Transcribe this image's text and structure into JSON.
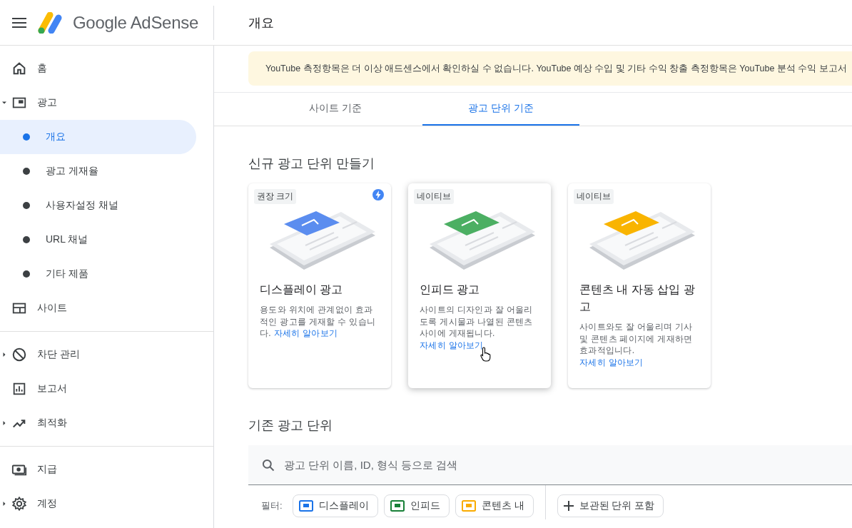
{
  "header": {
    "brand": "Google AdSense",
    "page_title": "개요"
  },
  "sidebar": {
    "groups": [
      {
        "items": [
          {
            "label": "홈"
          },
          {
            "label": "광고",
            "expanded": true,
            "children": [
              {
                "label": "개요",
                "selected": true
              },
              {
                "label": "광고 게재율",
                "selected": false
              },
              {
                "label": "사용자설정 채널",
                "selected": false
              },
              {
                "label": "URL 채널",
                "selected": false
              },
              {
                "label": "기타 제품",
                "selected": false
              }
            ]
          },
          {
            "label": "사이트"
          }
        ]
      },
      {
        "items": [
          {
            "label": "차단 관리",
            "expanded": false
          },
          {
            "label": "보고서"
          },
          {
            "label": "최적화",
            "expanded": false
          }
        ]
      },
      {
        "items": [
          {
            "label": "지급"
          },
          {
            "label": "계정",
            "expanded": false
          }
        ]
      }
    ]
  },
  "notice": "YouTube 측정항목은 더 이상 애드센스에서 확인하실 수 없습니다. YouTube 예상 수입 및 기타 수익 창출 측정항목은 YouTube 분석 수익 보고서",
  "tabs": [
    {
      "label": "사이트 기준",
      "selected": false
    },
    {
      "label": "광고 단위 기준",
      "selected": true
    }
  ],
  "new_section": {
    "title": "신규 광고 단위 만들기",
    "cards": [
      {
        "tag": "권장 크기",
        "recommended": true,
        "hovered": false,
        "color": "#5b8def",
        "title": "디스플레이 광고",
        "description": "용도와 위치에 관계없이 효과적인 광고를 게재할 수 있습니다.",
        "link": "자세히 알아보기"
      },
      {
        "tag": "네이티브",
        "recommended": false,
        "hovered": true,
        "color": "#4caf63",
        "title": "인피드 광고",
        "description": "사이트의 디자인과 잘 어울리도록 게시물과 나열된 콘텐츠 사이에 게재됩니다.",
        "link": "자세히 알아보기"
      },
      {
        "tag": "네이티브",
        "recommended": false,
        "hovered": false,
        "color": "#f9b400",
        "title": "콘텐츠 내 자동 삽입 광고",
        "description": "사이트와도 잘 어울리며 기사 및 콘텐츠 페이지에 게재하면 효과적입니다.",
        "link": "자세히 알아보기"
      }
    ]
  },
  "existing_section": {
    "title": "기존 광고 단위",
    "search": {
      "placeholder": "광고 단위 이름, ID, 형식 등으로 검색"
    },
    "filter_label": "필터:",
    "filters": [
      {
        "label": "디스플레이",
        "color": "#1a73e8"
      },
      {
        "label": "인피드",
        "color": "#188038"
      },
      {
        "label": "콘텐츠 내",
        "color": "#f9ab00"
      }
    ],
    "archived_button": "보관된 단위 포함"
  }
}
